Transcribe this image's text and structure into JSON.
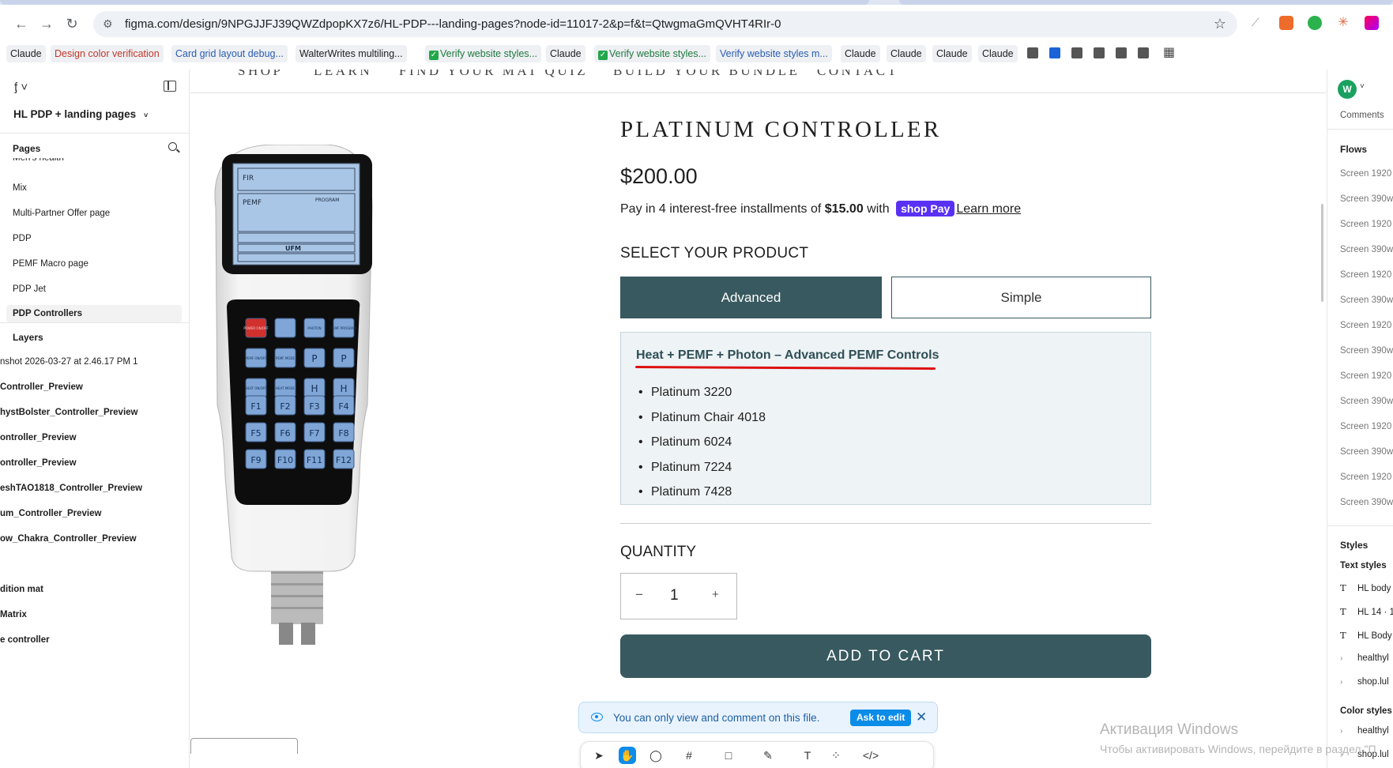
{
  "browser": {
    "url": "figma.com/design/9NPGJJFJ39QWZdpopKX7z6/HL-PDP---landing-pages?node-id=11017-2&p=f&t=QtwgmaGmQVHT4RIr-0",
    "bookmarks": [
      "Claude",
      "Design color verification",
      "Card grid layout debug...",
      "WalterWrites multiling...",
      "Verify website styles...",
      "Claude",
      "Verify website styles...",
      "Verify website styles m...",
      "Claude",
      "Claude",
      "Claude",
      "Claude"
    ]
  },
  "left_panel": {
    "file_title": "HL PDP + landing pages",
    "pages_label": "Pages",
    "pages": [
      "Men's health",
      "Mix",
      "Multi-Partner Offer page",
      "PDP",
      "PEMF Macro page",
      "PDP Jet",
      "PDP Controllers"
    ],
    "layers_label": "Layers",
    "layers": [
      "nshot 2026-03-27 at 2.46.17 PM 1",
      "Controller_Preview",
      "hystBolster_Controller_Preview",
      "ontroller_Preview",
      "ontroller_Preview",
      "eshTAO1818_Controller_Preview",
      "um_Controller_Preview",
      "ow_Chakra_Controller_Preview",
      "",
      "dition mat",
      "Matrix",
      "e controller",
      ""
    ]
  },
  "right_panel": {
    "avatar_initial": "W",
    "comments": "Comments",
    "flows_label": "Flows",
    "flows": [
      "Screen 1920",
      "Screen 390w",
      "Screen 1920",
      "Screen 390w",
      "Screen 1920",
      "Screen 390w",
      "Screen 1920",
      "Screen 390w",
      "Screen 1920",
      "Screen 390w",
      "Screen 1920",
      "Screen 390w",
      "Screen 1920",
      "Screen 390w"
    ],
    "styles_label": "Styles",
    "text_styles_label": "Text styles",
    "text_styles": [
      "HL body",
      "HL 14 · 1",
      "HL Body"
    ],
    "text_style_groups": [
      "healthyl",
      "shop.lul"
    ],
    "color_styles_label": "Color styles",
    "color_style_groups": [
      "healthyl",
      "shop.lul"
    ]
  },
  "canvas": {
    "nav": [
      "SHOP",
      "LEARN",
      "FIND YOUR MAT QUIZ",
      "BUILD YOUR BUNDLE",
      "CONTACT"
    ],
    "product_title": "PLATINUM CONTROLLER",
    "price": "$200.00",
    "installments_pre": "Pay in 4 interest-free installments of ",
    "installments_amount": "$15.00",
    "installments_post": " with ",
    "shoppay": "shop Pay",
    "learn_more": "Learn more",
    "select_title": "SELECT YOUR PRODUCT",
    "option_advanced": "Advanced",
    "option_simple": "Simple",
    "info_heading": "Heat + PEMF + Photon – Advanced PEMF Controls",
    "info_items": [
      "Platinum 3220",
      "Platinum Chair 4018",
      "Platinum 6024",
      "Platinum 7224",
      "Platinum 7428"
    ],
    "quantity_title": "QUANTITY",
    "quantity_minus": "−",
    "quantity_value": "1",
    "quantity_plus": "+",
    "add_to_cart": "ADD TO CART",
    "controller_display": {
      "fir": "FIR",
      "pemf": "PEMF",
      "program": "PROGRAM",
      "ufm": "UFM"
    },
    "controller_keys": [
      "POWER ON/OFF",
      "",
      "PHOTON",
      "PEMF PROGRAM",
      "PEMF ON/OFF",
      "PEMF MODE",
      "P",
      "P",
      "HEAT ON/OFF",
      "HEAT MODE",
      "H",
      "H",
      "F1",
      "F2",
      "F3",
      "F4",
      "F5",
      "F6",
      "F7",
      "F8",
      "F9",
      "F10",
      "F11",
      "F12"
    ]
  },
  "banner": {
    "message": "You can only view and comment on this file.",
    "ask_to_edit": "Ask to edit"
  },
  "watermark": {
    "line1": "Активация Windows",
    "line2": "Чтобы активировать Windows, перейдите в раздел \"П"
  }
}
